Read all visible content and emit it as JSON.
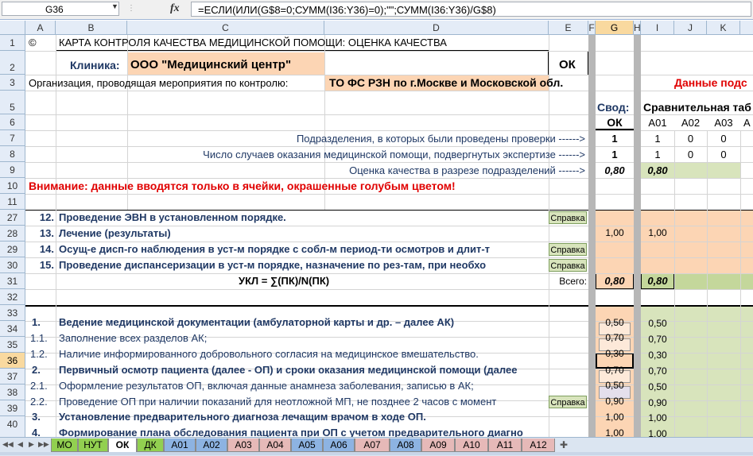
{
  "formula_bar": {
    "name_box": "G36",
    "fx_label": "fx",
    "formula": "=ЕСЛИ(ИЛИ(G$8=0;СУММ(I36:Y36)=0);\"\";СУММ(I36:Y36)/G$8)"
  },
  "columns": [
    "A",
    "B",
    "C",
    "D",
    "E",
    "F",
    "G",
    "H",
    "I",
    "J",
    "K"
  ],
  "rows": [
    "1",
    "2",
    "3",
    "5",
    "6",
    "7",
    "8",
    "9",
    "10",
    "11",
    "27",
    "28",
    "29",
    "30",
    "31",
    "32",
    "33",
    "34",
    "35",
    "36",
    "37",
    "38",
    "39",
    "40"
  ],
  "sheet": {
    "r1_a": "©",
    "r1_title": "КАРТА КОНТРОЛЯ КАЧЕСТВА МЕДИЦИНСКОЙ ПОМОЩИ: ОЦЕНКА КАЧЕСТВА",
    "r2_label": "Клиника:",
    "r2_value": "ООО \"Медицинский центр\"",
    "r2_ok": "ОК",
    "r3_label": "Организация, проводящая мероприятия по контролю:",
    "r3_value": "ТО ФС РЗН по г.Москве и Московской обл.",
    "r3_right": "Данные подс",
    "r5_svod": "Свод:",
    "r5_compare": "Сравнительная таб",
    "r6_ok": "ОК",
    "r6_a01": "А01",
    "r6_a02": "А02",
    "r6_a03": "А03",
    "r6_a04": "А",
    "r7_label": "Подразделения, в которых были проведены проверки  ------>",
    "r7_g": "1",
    "r7_i": "1",
    "r7_j": "0",
    "r7_k": "0",
    "r8_label": "Число случаев оказания медицинской помощи, подвергнутых экспертизе ------>",
    "r8_g": "1",
    "r8_i": "1",
    "r8_j": "0",
    "r8_k": "0",
    "r9_label": "Оценка качества в разрезе подразделений  ------>",
    "r9_g": "0,80",
    "r9_i": "0,80",
    "r10_warn": "Внимание: данные вводятся только в ячейки, окрашенные голубым цветом!",
    "r27_num": "12.",
    "r27_text": "Проведение ЭВН в установленном порядке.",
    "r27_btn": "Справка",
    "r28_num": "13.",
    "r28_text": "Лечение (результаты)",
    "r28_g": "1,00",
    "r28_i": "1,00",
    "r29_num": "14.",
    "r29_text": "Осущ-е дисп-го наблюдения в уст-м порядке с собл-м период-ти осмотров и длит-т",
    "r29_btn": "Справка",
    "r30_num": "15.",
    "r30_text": "Проведение диспансеризации в уст-м порядке, назначение по рез-там, при необхо",
    "r30_btn": "Справка",
    "r31_formula": "УКЛ = ∑(ПК)/N(ПК)",
    "r31_total": "Всего:",
    "r31_g": "0,80",
    "r31_i": "0,80",
    "r33_num": "1.",
    "r33_text": "Ведение медицинской документации (амбулаторной карты и др. – далее АК)",
    "r33_g": "0,50",
    "r33_i": "0,50",
    "r34_num": "1.1.",
    "r34_text": "Заполнение всех разделов АК;",
    "r34_g": "0,70",
    "r34_i": "0,70",
    "r35_num": "1.2.",
    "r35_text": "Наличие информированного добровольного согласия на медицинское вмешательство.",
    "r35_g": "0,30",
    "r35_i": "0,30",
    "r36_num": "2.",
    "r36_text": "Первичный осмотр пациента (далее - ОП) и сроки оказания медицинской помощи (далее",
    "r36_g": "0,70",
    "r36_i": "0,70",
    "r37_num": "2.1.",
    "r37_text": "Оформление результатов ОП, включая данные анамнеза заболевания, записью в АК;",
    "r37_g": "0,50",
    "r37_i": "0,50",
    "r38_num": "2.2.",
    "r38_text": "Проведение ОП при наличии показаний для неотложной МП, не позднее 2 часов с момент",
    "r38_btn": "Справка",
    "r38_g": "0,90",
    "r38_i": "0,90",
    "r39_num": "3.",
    "r39_text": "Установление предварительного диагноза лечащим врачом в ходе ОП.",
    "r39_g": "1,00",
    "r39_i": "1,00",
    "r40_num": "4.",
    "r40_text": "Формирование плана обследования пациента при ОП с учетом предварительного диагно",
    "r40_g": "1,00",
    "r40_i": "1,00"
  },
  "tabs": [
    "МО",
    "НУТ",
    "ОК",
    "ДК",
    "А01",
    "А02",
    "А03",
    "А04",
    "А05",
    "А06",
    "А07",
    "А08",
    "А09",
    "А10",
    "А11",
    "А12"
  ],
  "active_tab": "ОК",
  "colors": {
    "peach": "#fcd5b4",
    "green_light": "#d8e4bc",
    "green": "#c4d79b",
    "tab_green": "#92d050",
    "tab_blue": "#8db3e2",
    "tab_pink": "#e6b9b8",
    "red": "#e00000",
    "navy": "#1f3864"
  }
}
